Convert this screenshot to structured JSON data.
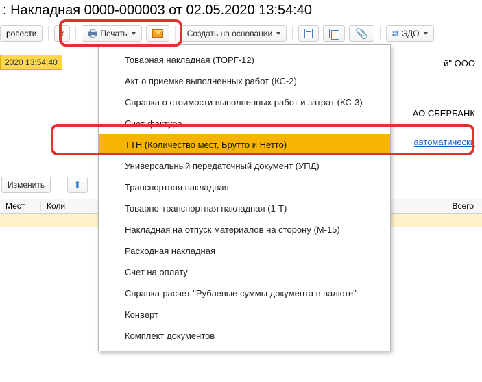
{
  "title": ": Накладная 0000-000003 от 02.05.2020 13:54:40",
  "toolbar": {
    "rovesti": "ровести",
    "print_label": "Печать",
    "create_based": "Создать на основании",
    "edo": "ЭДО"
  },
  "background": {
    "date_chip": "2020 13:54:40",
    "company_suffix": "й\" ООО",
    "bank": "АО СБЕРБАНК",
    "link": "автоматически",
    "change_btn": "Изменить"
  },
  "table": {
    "mest": "Мест",
    "koli": "Коли",
    "vsego": "Всего"
  },
  "dropdown": {
    "items": [
      "Товарная накладная (ТОРГ-12)",
      "Акт о приемке выполненных работ (КС-2)",
      "Справка о стоимости выполненных работ и затрат (КС-3)",
      "Счет-фактура",
      "ТТН (Количество мест, Брутто и Нетто)",
      "Универсальный передаточный документ (УПД)",
      "Транспортная накладная",
      "Товарно-транспортная накладная (1-Т)",
      "Накладная на отпуск материалов на сторону (М-15)",
      "Расходная накладная",
      "Счет на оплату",
      "Справка-расчет \"Рублевые суммы документа в валюте\"",
      "Конверт",
      "Комплект документов"
    ],
    "selected_index": 4
  }
}
